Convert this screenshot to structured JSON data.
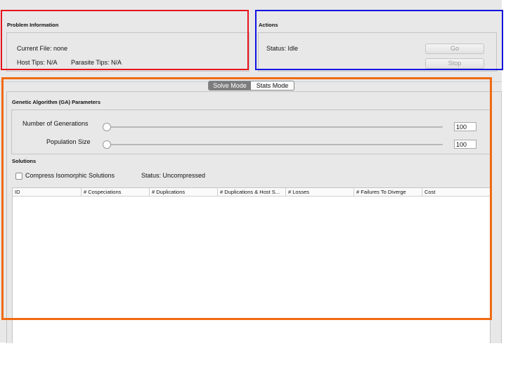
{
  "problem_info": {
    "title": "Problem Information",
    "current_file": "Current File: none",
    "host_tips": "Host Tips: N/A",
    "parasite_tips": "Parasite Tips: N/A"
  },
  "actions": {
    "title": "Actions",
    "status": "Status: Idle",
    "go_label": "Go",
    "stop_label": "Stop"
  },
  "mode_tabs": [
    {
      "label": "Solve Mode",
      "selected": true
    },
    {
      "label": "Stats Mode",
      "selected": false
    }
  ],
  "ga_params": {
    "title": "Genetic Algorithm (GA) Parameters",
    "generations": {
      "label": "Number of Generations",
      "value": "100",
      "slider_fraction": 0
    },
    "population": {
      "label": "Population Size",
      "value": "100",
      "slider_fraction": 0
    }
  },
  "solutions": {
    "title": "Solutions",
    "compress_label": "Compress Isomorphic Solutions",
    "compress_checked": false,
    "status": "Status: Uncompressed",
    "columns": [
      "ID",
      "# Cospeciations",
      "# Duplications",
      "# Duplications & Host S...",
      "# Losses",
      "# Failures To Diverge",
      "Cost"
    ],
    "rows": []
  },
  "highlight_colors": {
    "problem_info": "#e8121d",
    "actions": "#1313e0",
    "main": "#f06a12"
  }
}
